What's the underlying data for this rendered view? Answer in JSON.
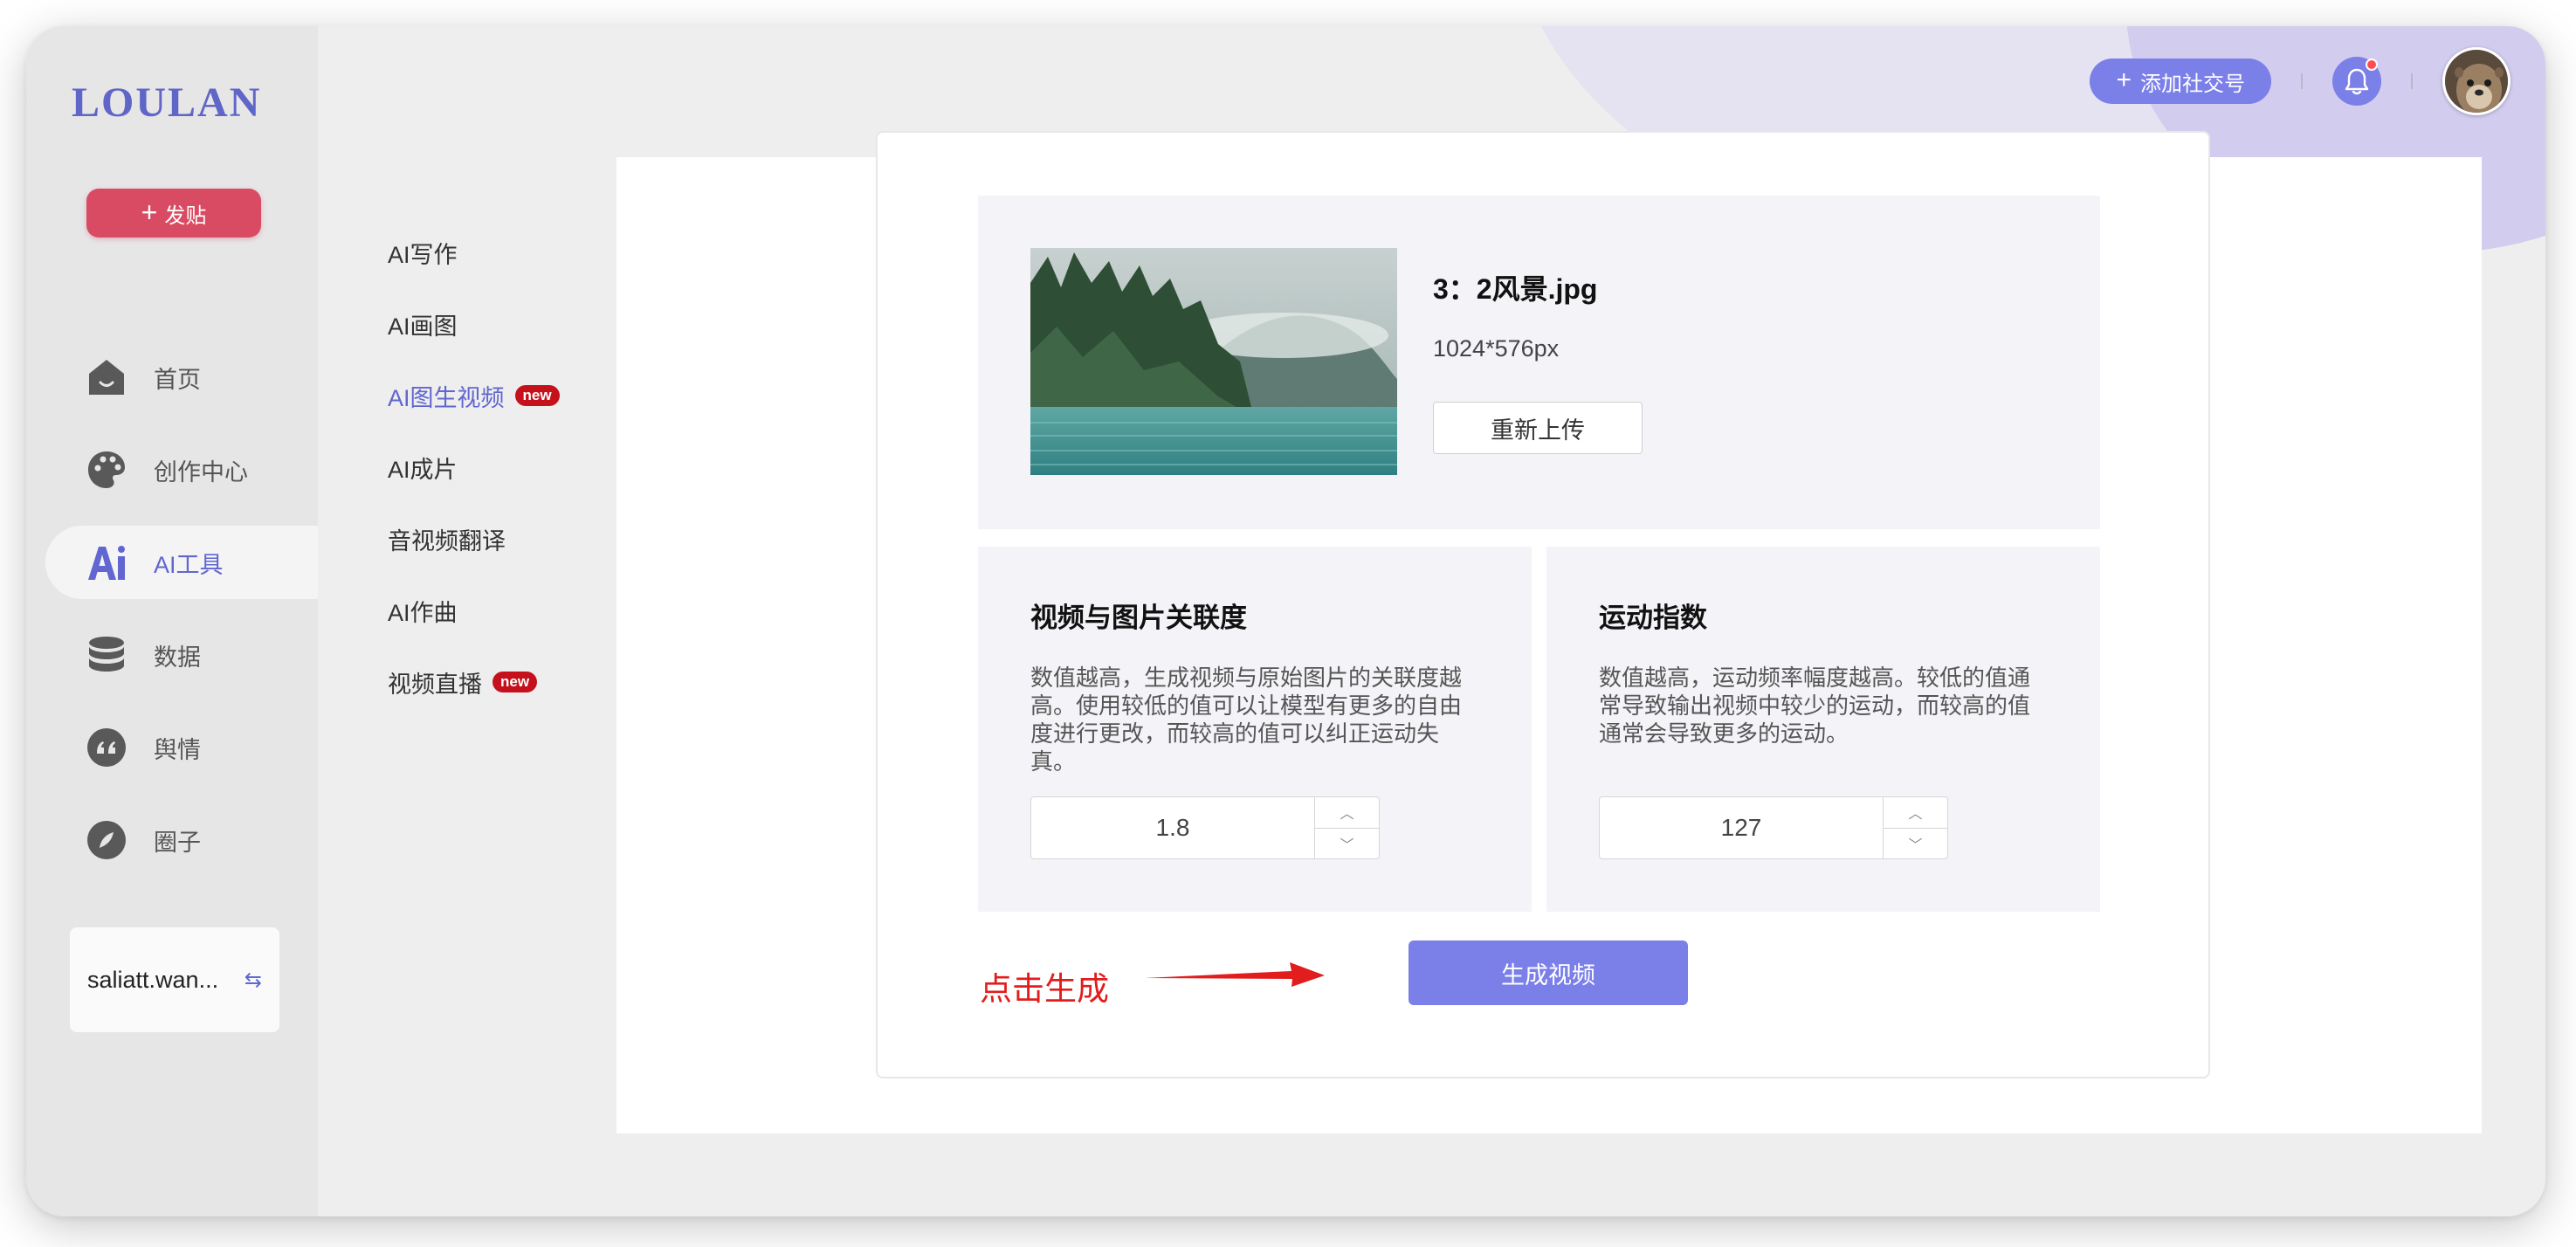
{
  "brand": {
    "logo": "LOULAN"
  },
  "sidebar": {
    "post_button": "发贴",
    "items": [
      {
        "label": "首页",
        "icon": "home-icon"
      },
      {
        "label": "创作中心",
        "icon": "palette-icon"
      },
      {
        "label": "AI工具",
        "icon": "ai-icon",
        "active": true
      },
      {
        "label": "数据",
        "icon": "database-icon"
      },
      {
        "label": "舆情",
        "icon": "quote-icon"
      },
      {
        "label": "圈子",
        "icon": "compass-icon"
      }
    ],
    "account": "saliatt.wan..."
  },
  "header": {
    "add_social_button": "添加社交号",
    "notification_dot": true
  },
  "submenu": {
    "items": [
      {
        "label": "AI写作",
        "badge": ""
      },
      {
        "label": "AI画图",
        "badge": ""
      },
      {
        "label": "AI图生视频",
        "badge": "new",
        "active": true
      },
      {
        "label": "AI成片",
        "badge": ""
      },
      {
        "label": "音视频翻译",
        "badge": ""
      },
      {
        "label": "AI作曲",
        "badge": ""
      },
      {
        "label": "视频直播",
        "badge": "new"
      }
    ]
  },
  "upload": {
    "file_name": "3：2风景.jpg",
    "dimensions": "1024*576px",
    "reupload_button": "重新上传"
  },
  "params": {
    "relevance": {
      "title": "视频与图片关联度",
      "description": "数值越高，生成视频与原始图片的关联度越高。使用较低的值可以让模型有更多的自由度进行更改，而较高的值可以纠正运动失真。",
      "value": "1.8"
    },
    "motion": {
      "title": "运动指数",
      "description": "数值越高，运动频率幅度越高。较低的值通常导致输出视频中较少的运动，而较高的值通常会导致更多的运动。",
      "value": "127"
    }
  },
  "actions": {
    "hint": "点击生成",
    "generate_button": "生成视频"
  },
  "colors": {
    "accent": "#7b7fe8",
    "active_text": "#6166d0",
    "post_button": "#d84b63",
    "hint_red": "#e11d1d",
    "badge_red": "#c4111c"
  }
}
